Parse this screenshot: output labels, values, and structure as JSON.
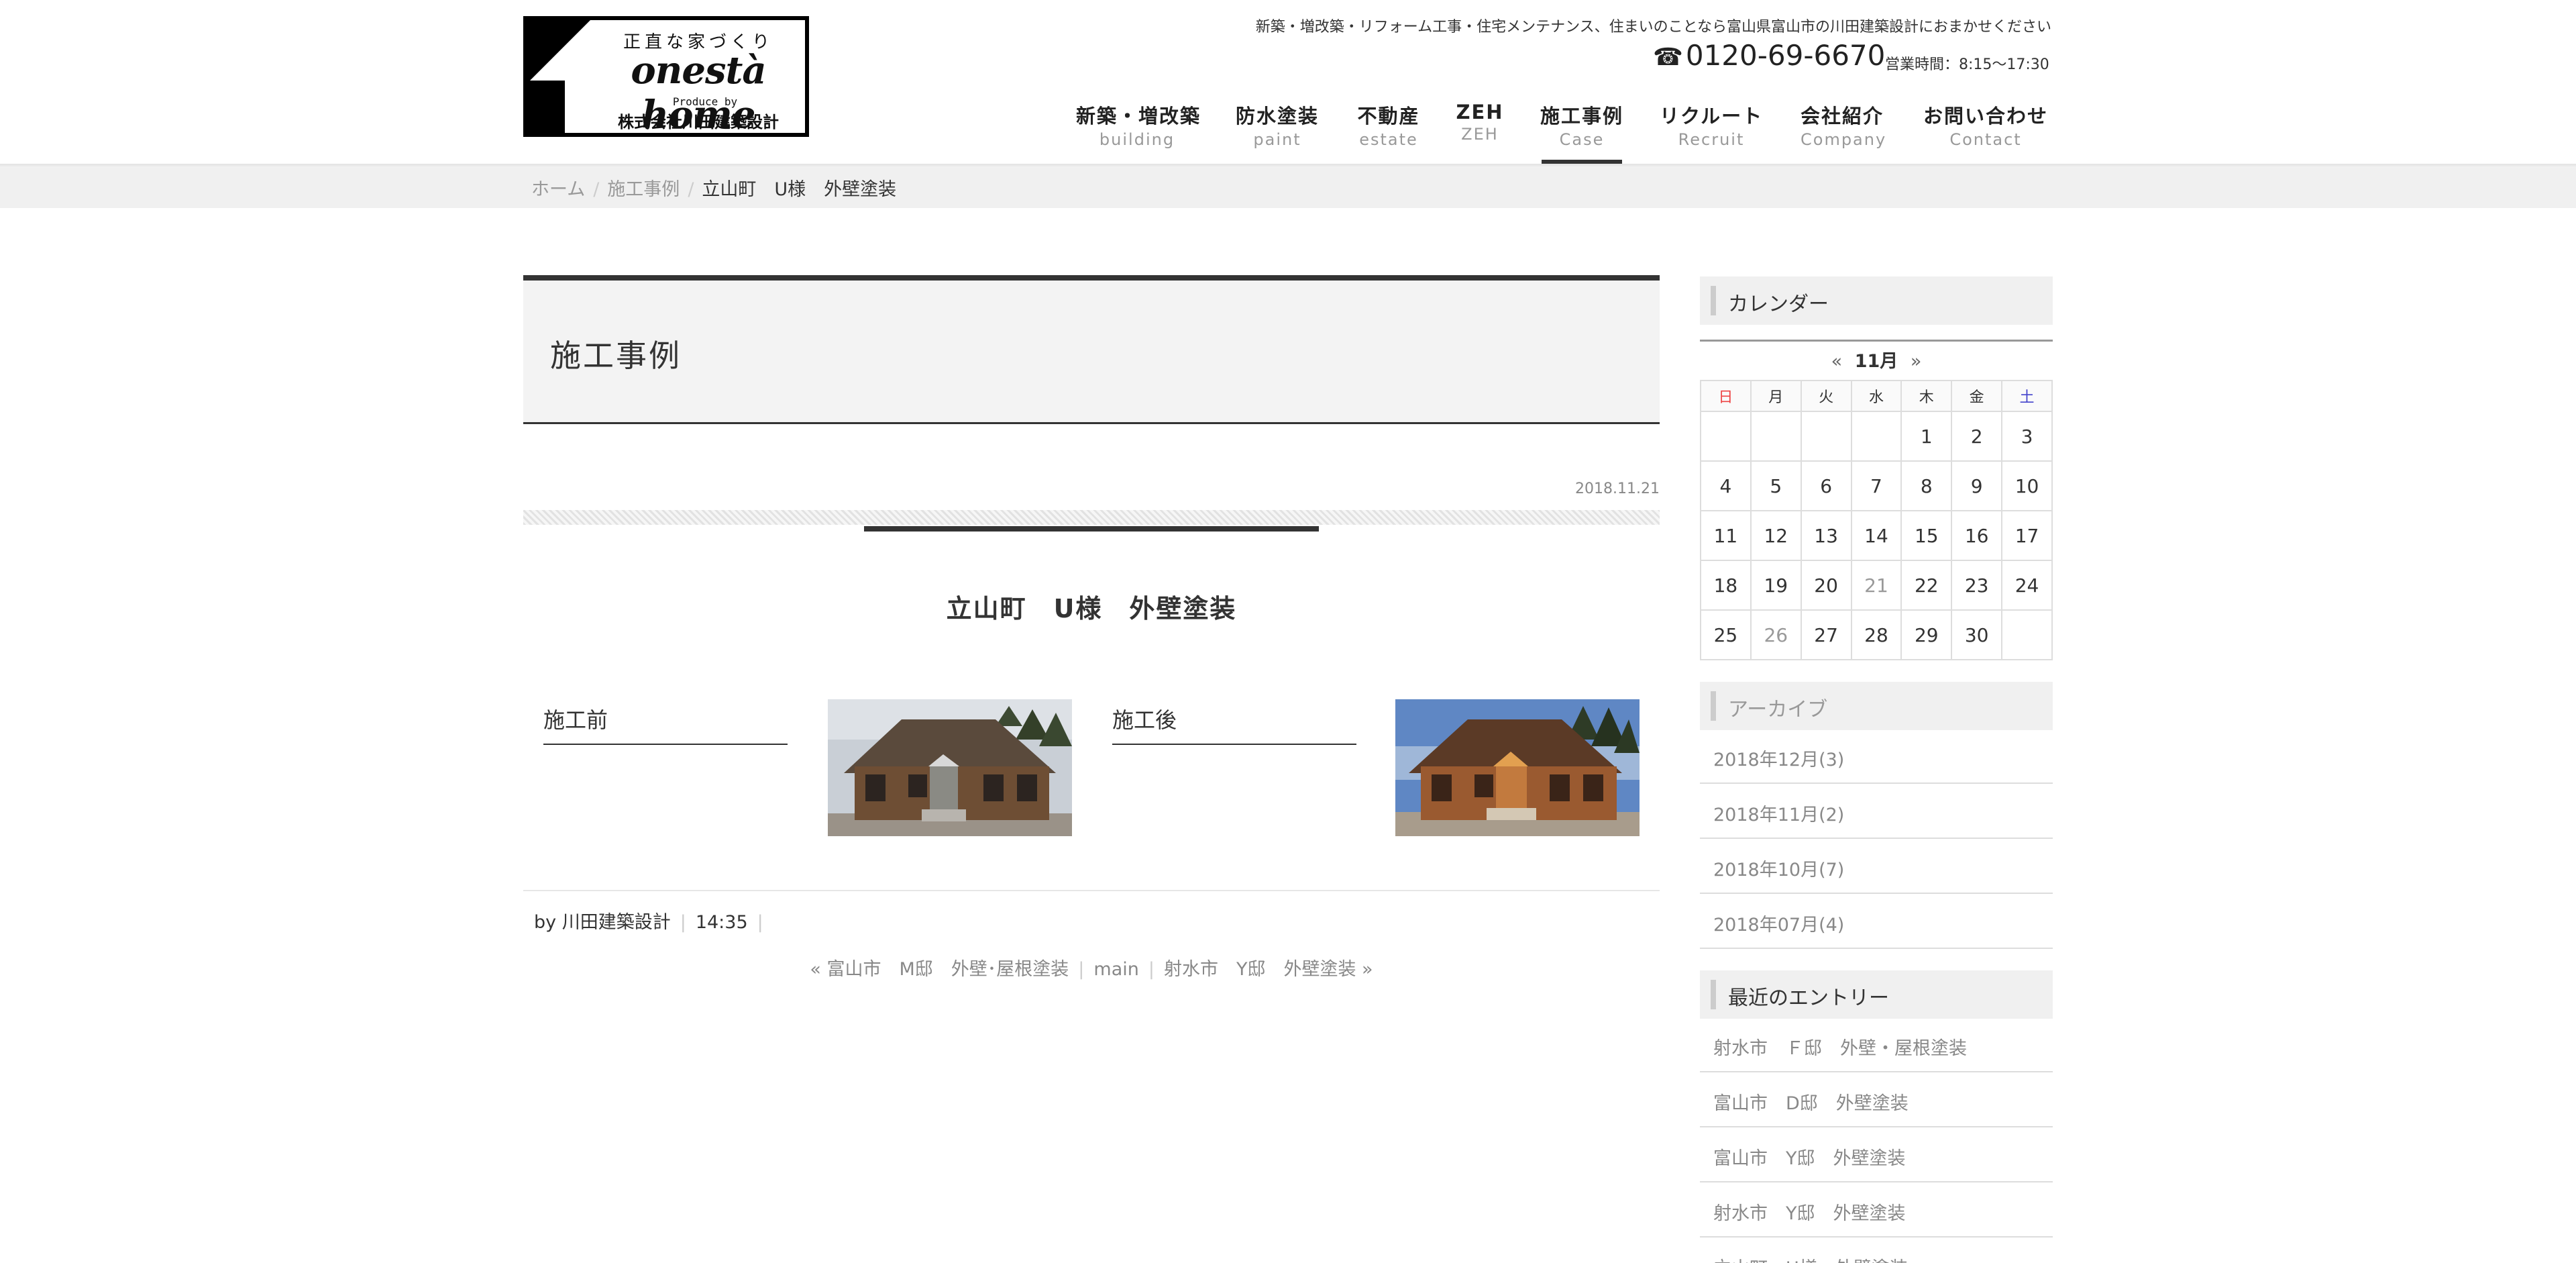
{
  "header": {
    "tagline": "新築・増改築・リフォーム工事・住宅メンテナンス、住まいのことなら富山県富山市の川田建築設計におまかせください",
    "phone": "0120-69-6670",
    "hours": "営業時間：8:15〜17:30",
    "logo": {
      "tag": "正直な家づくり",
      "main": "onestà home",
      "produce": "Produce by",
      "company": "株式会社川田建築設計"
    }
  },
  "nav": [
    {
      "jp": "新築・増改築",
      "en": "building"
    },
    {
      "jp": "防水塗装",
      "en": "paint"
    },
    {
      "jp": "不動産",
      "en": "estate"
    },
    {
      "jp": "ZEH",
      "en": "ZEH"
    },
    {
      "jp": "施工事例",
      "en": "Case"
    },
    {
      "jp": "リクルート",
      "en": "Recruit"
    },
    {
      "jp": "会社紹介",
      "en": "Company"
    },
    {
      "jp": "お問い合わせ",
      "en": "Contact"
    }
  ],
  "breadcrumb": {
    "home": "ホーム",
    "section": "施工事例",
    "current": "立山町　U様　外壁塗装"
  },
  "page_title": "施工事例",
  "post": {
    "date": "2018.11.21",
    "title": "立山町　U様　外壁塗装",
    "before_label": "施工前",
    "after_label": "施工後",
    "author": "by 川田建築設計",
    "time": "14:35",
    "prev": "« 富山市　M邸　外壁･屋根塗装",
    "main": "main",
    "next": "射水市　Y邸　外壁塗装 »"
  },
  "sidebar": {
    "calendar_title": "カレンダー",
    "calendar": {
      "prev": "«",
      "month": "11月",
      "next": "»",
      "weekdays": [
        "日",
        "月",
        "火",
        "水",
        "木",
        "金",
        "土"
      ],
      "weeks": [
        [
          "",
          "",
          "",
          "",
          "1",
          "2",
          "3"
        ],
        [
          "4",
          "5",
          "6",
          "7",
          "8",
          "9",
          "10"
        ],
        [
          "11",
          "12",
          "13",
          "14",
          "15",
          "16",
          "17"
        ],
        [
          "18",
          "19",
          "20",
          "21",
          "22",
          "23",
          "24"
        ],
        [
          "25",
          "26",
          "27",
          "28",
          "29",
          "30",
          ""
        ]
      ]
    },
    "archive_title": "アーカイブ",
    "archives": [
      "2018年12月(3)",
      "2018年11月(2)",
      "2018年10月(7)",
      "2018年07月(4)"
    ],
    "recent_title": "最近のエントリー",
    "recent": [
      "射水市　Ｆ邸　外壁・屋根塗装",
      "富山市　D邸　外壁塗装",
      "富山市　Y邸　外壁塗装",
      "射水市　Y邸　外壁塗装",
      "立山町　U様　外壁塗装"
    ]
  },
  "colors": {
    "accent": "#333333",
    "sunday": "#ee4444",
    "saturday": "#4444cc",
    "muted": "#999999"
  }
}
